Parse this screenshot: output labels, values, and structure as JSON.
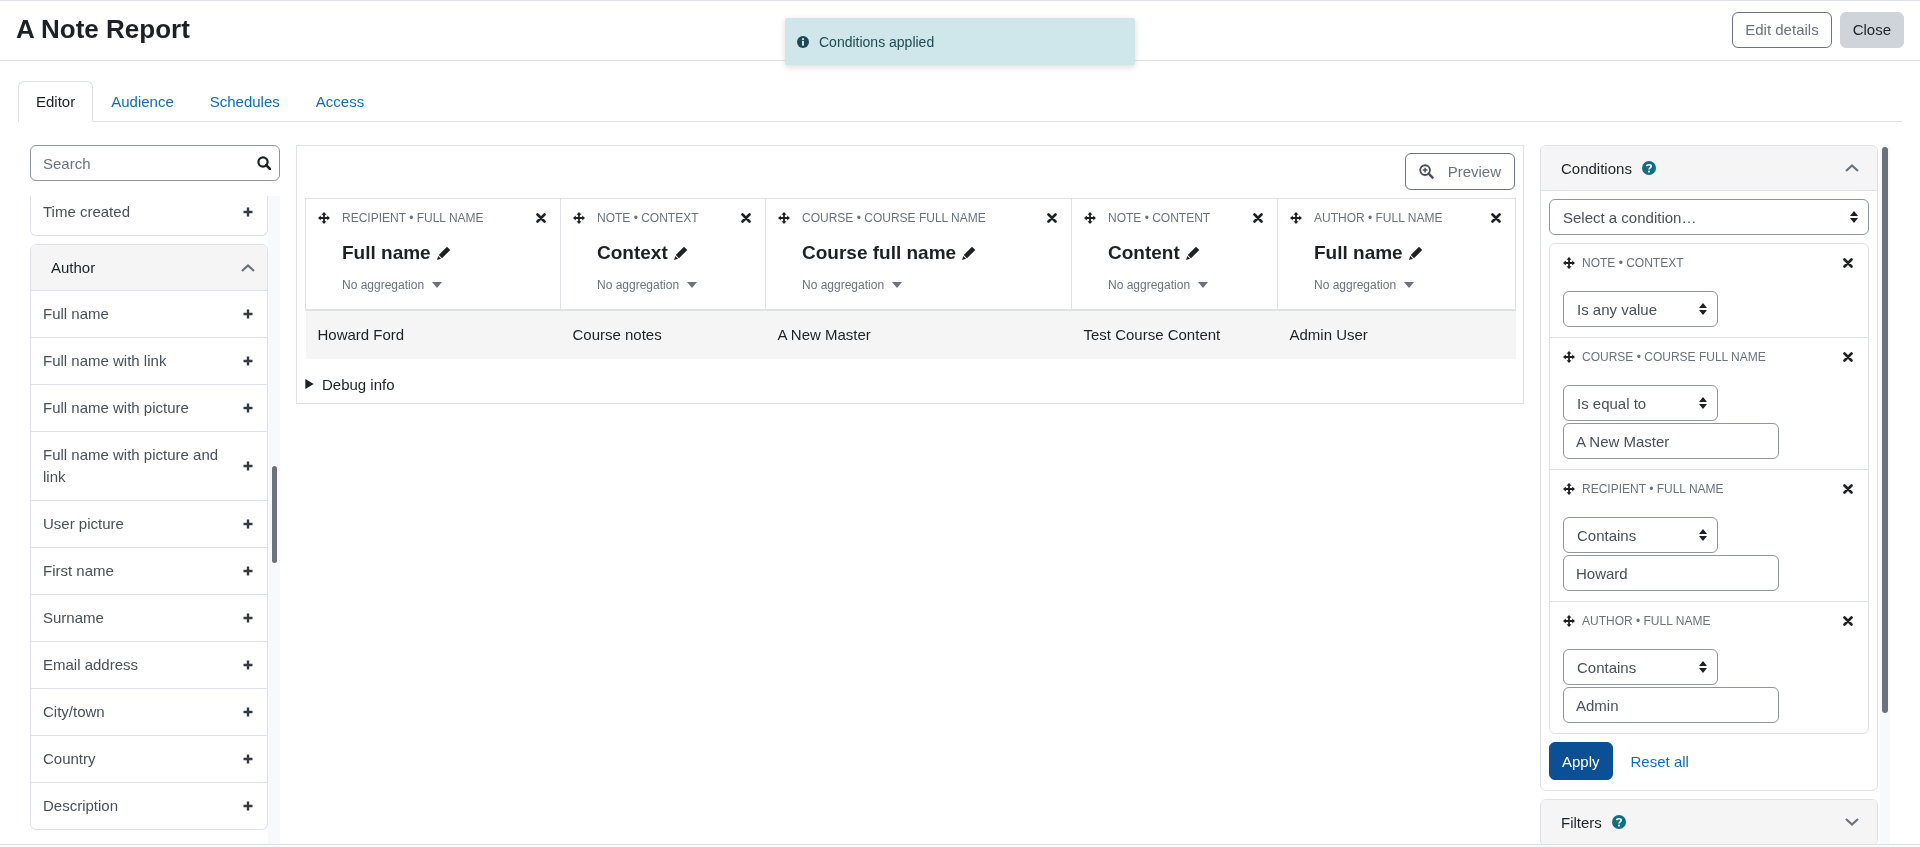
{
  "page_title": "A Note Report",
  "toast": {
    "text": "Conditions applied"
  },
  "header_buttons": [
    {
      "label": "Edit details",
      "kind": "outline"
    },
    {
      "label": "Close",
      "kind": "secondary"
    }
  ],
  "tabs": [
    {
      "label": "Editor",
      "selected": true
    },
    {
      "label": "Audience",
      "selected": false
    },
    {
      "label": "Schedules",
      "selected": false
    },
    {
      "label": "Access",
      "selected": false
    }
  ],
  "sidebar": {
    "search": {
      "placeholder": "Search"
    },
    "groups": [
      {
        "items": [
          "Time created"
        ]
      },
      {
        "title": "Author",
        "expanded": true,
        "items": [
          "Full name",
          "Full name with link",
          "Full name with picture",
          "Full name with picture and link",
          "User picture",
          "First name",
          "Surname",
          "Email address",
          "City/town",
          "Country",
          "Description"
        ]
      }
    ]
  },
  "report": {
    "preview_button": "Preview",
    "columns": [
      {
        "source": "RECIPIENT • FULL NAME",
        "title": "Full name",
        "aggregation": "No aggregation"
      },
      {
        "source": "NOTE • CONTEXT",
        "title": "Context",
        "aggregation": "No aggregation"
      },
      {
        "source": "COURSE • COURSE FULL NAME",
        "title": "Course full name",
        "aggregation": "No aggregation"
      },
      {
        "source": "NOTE • CONTENT",
        "title": "Content",
        "aggregation": "No aggregation"
      },
      {
        "source": "AUTHOR • FULL NAME",
        "title": "Full name",
        "aggregation": "No aggregation"
      }
    ],
    "rows": [
      [
        "Howard Ford",
        "Course notes",
        "A New Master",
        "Test Course Content",
        "Admin User"
      ]
    ],
    "debug": {
      "label": "Debug info",
      "expanded": false
    }
  },
  "conditions": {
    "title": "Conditions",
    "expanded": true,
    "select_placeholder": "Select a condition…",
    "items": [
      {
        "source": "NOTE • CONTEXT",
        "operator": "Is any value"
      },
      {
        "source": "COURSE • COURSE FULL NAME",
        "operator": "Is equal to",
        "value": "A New Master"
      },
      {
        "source": "RECIPIENT • FULL NAME",
        "operator": "Contains",
        "value": "Howard"
      },
      {
        "source": "AUTHOR • FULL NAME",
        "operator": "Contains",
        "value": "Admin"
      }
    ],
    "apply_button": "Apply",
    "reset_link": "Reset all"
  },
  "filters": {
    "title": "Filters",
    "expanded": false
  }
}
